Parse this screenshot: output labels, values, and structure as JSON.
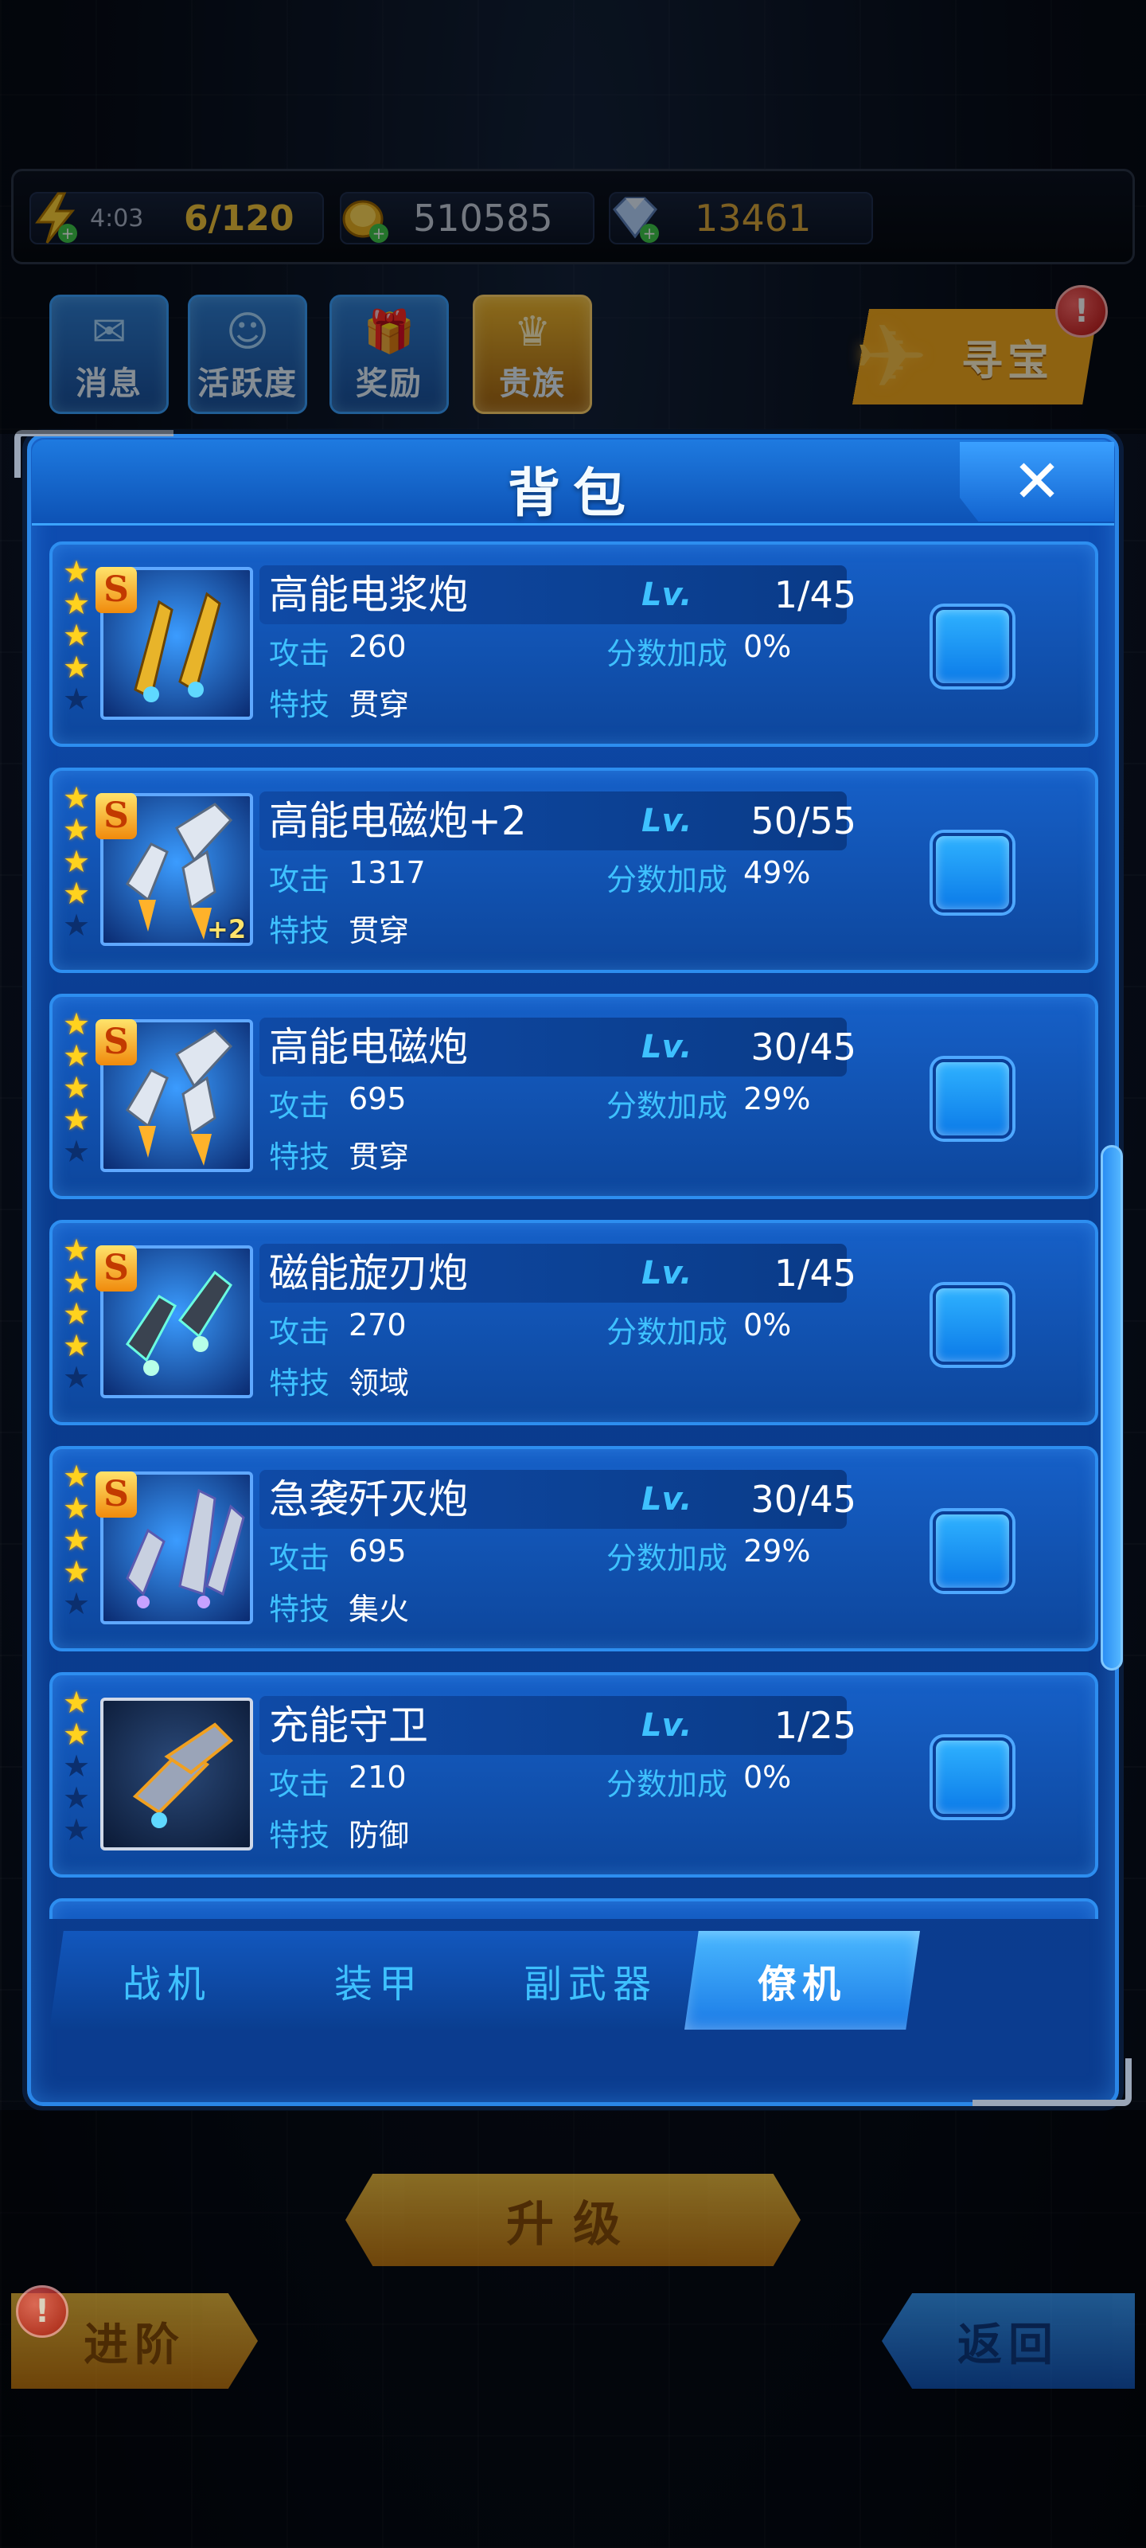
{
  "resources": {
    "energy": {
      "timer": "4:03",
      "value": "6/120"
    },
    "gold": {
      "value": "510585"
    },
    "gems": {
      "value": "13461"
    }
  },
  "menu": {
    "messages": "消息",
    "activity": "活跃度",
    "rewards": "奖励",
    "vip": "贵族",
    "treasure": "寻宝",
    "treasure_badge": "!"
  },
  "panel": {
    "title": "背包",
    "close_label": "✕"
  },
  "labels": {
    "attack": "攻击",
    "score_bonus": "分数加成",
    "skill": "特技",
    "lv": "Lv."
  },
  "items": [
    {
      "name": "高能电浆炮",
      "rank": "S",
      "stars": 4,
      "max_stars": 5,
      "level": "1/45",
      "attack": "260",
      "score_bonus": "0%",
      "skill": "贯穿",
      "plus": ""
    },
    {
      "name": "高能电磁炮+2",
      "rank": "S",
      "stars": 4,
      "max_stars": 5,
      "level": "50/55",
      "attack": "1317",
      "score_bonus": "49%",
      "skill": "贯穿",
      "plus": "+2"
    },
    {
      "name": "高能电磁炮",
      "rank": "S",
      "stars": 4,
      "max_stars": 5,
      "level": "30/45",
      "attack": "695",
      "score_bonus": "29%",
      "skill": "贯穿",
      "plus": ""
    },
    {
      "name": "磁能旋刃炮",
      "rank": "S",
      "stars": 4,
      "max_stars": 5,
      "level": "1/45",
      "attack": "270",
      "score_bonus": "0%",
      "skill": "领域",
      "plus": ""
    },
    {
      "name": "急袭歼灭炮",
      "rank": "S",
      "stars": 4,
      "max_stars": 5,
      "level": "30/45",
      "attack": "695",
      "score_bonus": "29%",
      "skill": "集火",
      "plus": ""
    },
    {
      "name": "充能守卫",
      "rank": "",
      "stars": 2,
      "max_stars": 5,
      "level": "1/25",
      "attack": "210",
      "score_bonus": "0%",
      "skill": "防御",
      "plus": ""
    }
  ],
  "tabs": [
    "战机",
    "装甲",
    "副武器",
    "僚机"
  ],
  "active_tab": 3,
  "buttons": {
    "upgrade": "升级",
    "advance": "进阶",
    "advance_badge": "!",
    "back": "返回"
  },
  "colors": {
    "panel_blue": "#0f4fb6",
    "label_cyan": "#3ec1ff",
    "gold_button": "#f6c23a",
    "star_yellow": "#ffd21e"
  }
}
